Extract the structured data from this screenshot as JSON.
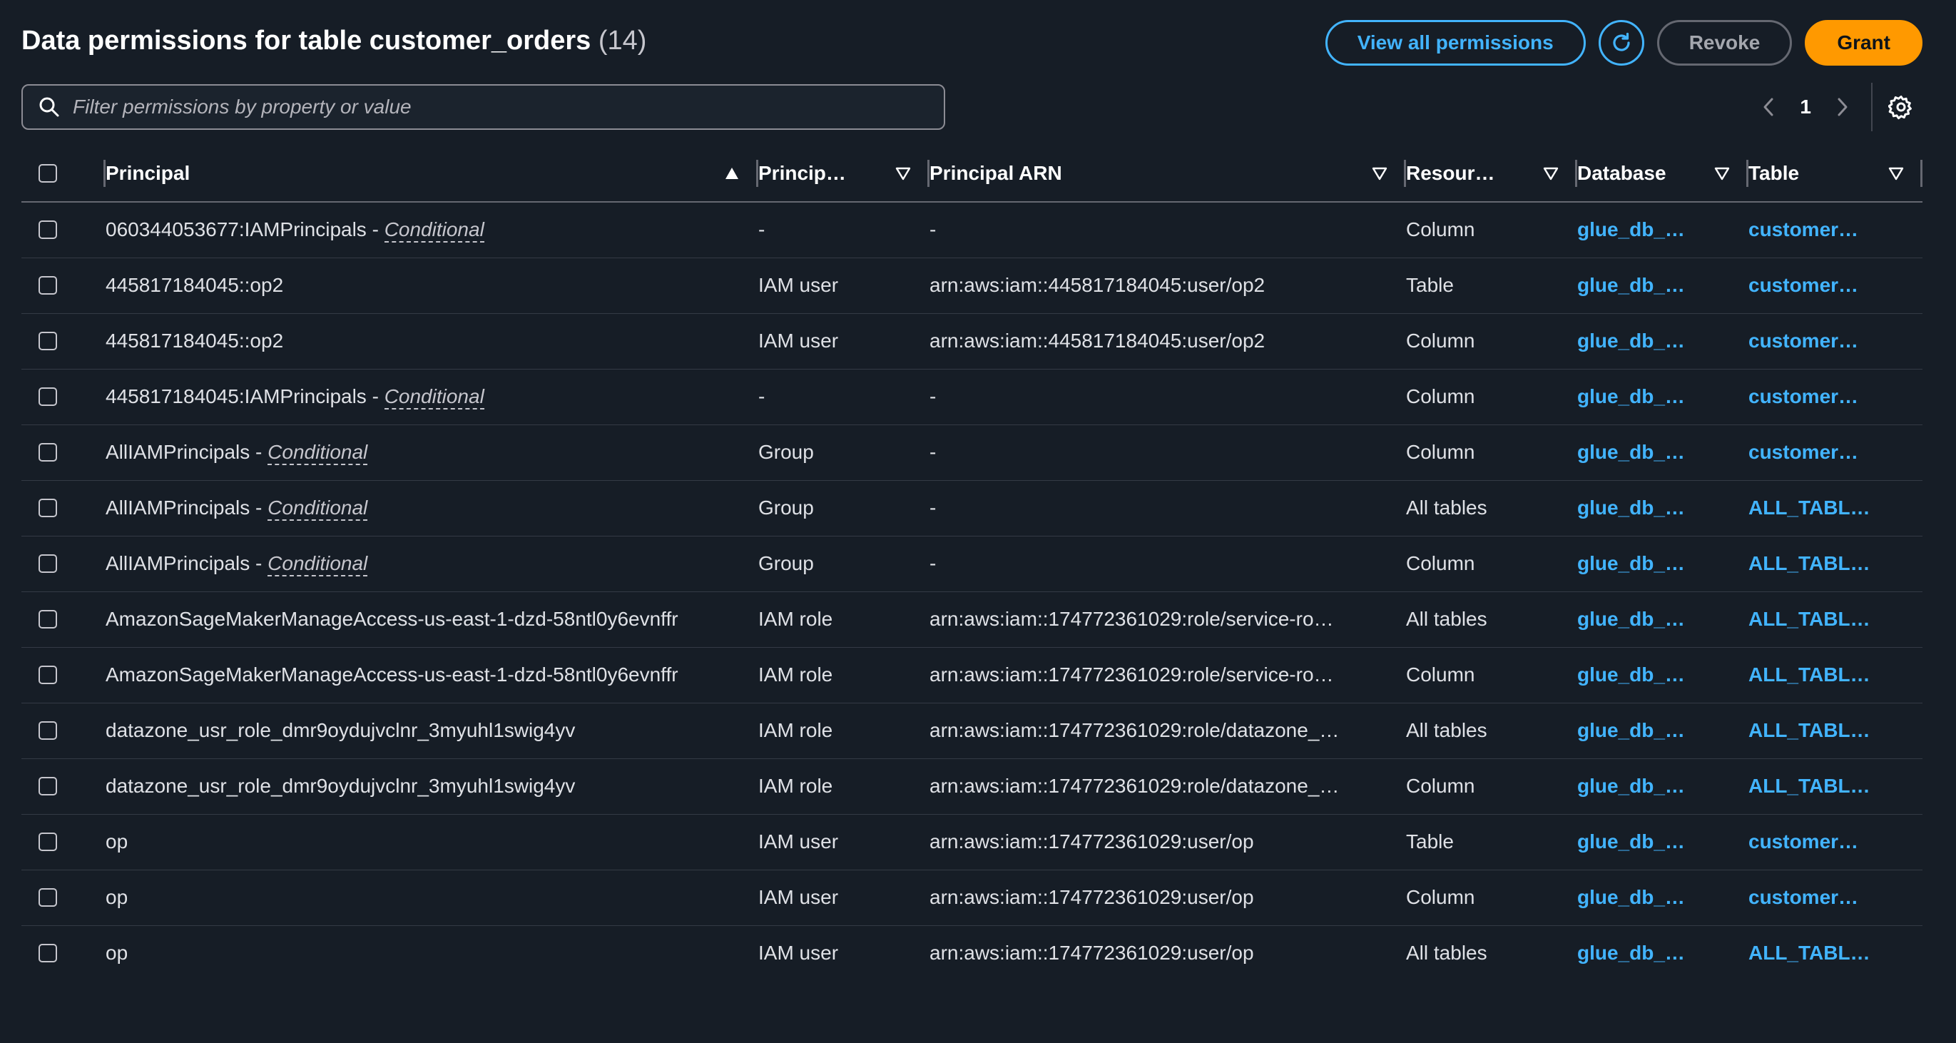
{
  "header": {
    "title": "Data permissions for table customer_orders",
    "count": "(14)",
    "view_all_label": "View all permissions",
    "refresh_icon": "refresh-icon",
    "revoke_label": "Revoke",
    "grant_label": "Grant"
  },
  "filter": {
    "placeholder": "Filter permissions by property or value",
    "icon": "search-icon"
  },
  "pagination": {
    "current_page": "1",
    "prev_icon": "chevron-left-icon",
    "next_icon": "chevron-right-icon",
    "settings_icon": "gear-icon"
  },
  "columns": {
    "principal": "Principal",
    "principal_type": "Princip…",
    "principal_arn": "Principal ARN",
    "resource_type": "Resour…",
    "database": "Database",
    "table": "Table"
  },
  "rows": [
    {
      "principal": "060344053677:IAMPrincipals - ",
      "conditional": "Conditional",
      "ptype": "-",
      "arn": "-",
      "resource": "Column",
      "database": "glue_db_…",
      "table": "customer…"
    },
    {
      "principal": "445817184045::op2",
      "conditional": "",
      "ptype": "IAM user",
      "arn": "arn:aws:iam::445817184045:user/op2",
      "resource": "Table",
      "database": "glue_db_…",
      "table": "customer…"
    },
    {
      "principal": "445817184045::op2",
      "conditional": "",
      "ptype": "IAM user",
      "arn": "arn:aws:iam::445817184045:user/op2",
      "resource": "Column",
      "database": "glue_db_…",
      "table": "customer…"
    },
    {
      "principal": "445817184045:IAMPrincipals - ",
      "conditional": "Conditional",
      "ptype": "-",
      "arn": "-",
      "resource": "Column",
      "database": "glue_db_…",
      "table": "customer…"
    },
    {
      "principal": "AllIAMPrincipals - ",
      "conditional": "Conditional",
      "ptype": "Group",
      "arn": "-",
      "resource": "Column",
      "database": "glue_db_…",
      "table": "customer…"
    },
    {
      "principal": "AllIAMPrincipals - ",
      "conditional": "Conditional",
      "ptype": "Group",
      "arn": "-",
      "resource": "All tables",
      "database": "glue_db_…",
      "table": "ALL_TABL…"
    },
    {
      "principal": "AllIAMPrincipals - ",
      "conditional": "Conditional",
      "ptype": "Group",
      "arn": "-",
      "resource": "Column",
      "database": "glue_db_…",
      "table": "ALL_TABL…"
    },
    {
      "principal": "AmazonSageMakerManageAccess-us-east-1-dzd-58ntl0y6evnffr",
      "conditional": "",
      "ptype": "IAM role",
      "arn": "arn:aws:iam::174772361029:role/service-ro…",
      "resource": "All tables",
      "database": "glue_db_…",
      "table": "ALL_TABL…"
    },
    {
      "principal": "AmazonSageMakerManageAccess-us-east-1-dzd-58ntl0y6evnffr",
      "conditional": "",
      "ptype": "IAM role",
      "arn": "arn:aws:iam::174772361029:role/service-ro…",
      "resource": "Column",
      "database": "glue_db_…",
      "table": "ALL_TABL…"
    },
    {
      "principal": "datazone_usr_role_dmr9oydujvclnr_3myuhl1swig4yv",
      "conditional": "",
      "ptype": "IAM role",
      "arn": "arn:aws:iam::174772361029:role/datazone_…",
      "resource": "All tables",
      "database": "glue_db_…",
      "table": "ALL_TABL…"
    },
    {
      "principal": "datazone_usr_role_dmr9oydujvclnr_3myuhl1swig4yv",
      "conditional": "",
      "ptype": "IAM role",
      "arn": "arn:aws:iam::174772361029:role/datazone_…",
      "resource": "Column",
      "database": "glue_db_…",
      "table": "ALL_TABL…"
    },
    {
      "principal": "op",
      "conditional": "",
      "ptype": "IAM user",
      "arn": "arn:aws:iam::174772361029:user/op",
      "resource": "Table",
      "database": "glue_db_…",
      "table": "customer…"
    },
    {
      "principal": "op",
      "conditional": "",
      "ptype": "IAM user",
      "arn": "arn:aws:iam::174772361029:user/op",
      "resource": "Column",
      "database": "glue_db_…",
      "table": "customer…"
    },
    {
      "principal": "op",
      "conditional": "",
      "ptype": "IAM user",
      "arn": "arn:aws:iam::174772361029:user/op",
      "resource": "All tables",
      "database": "glue_db_…",
      "table": "ALL_TABL…"
    }
  ],
  "colors": {
    "background": "#161d26",
    "link": "#42b4ff",
    "primary_button": "#ff9900"
  }
}
